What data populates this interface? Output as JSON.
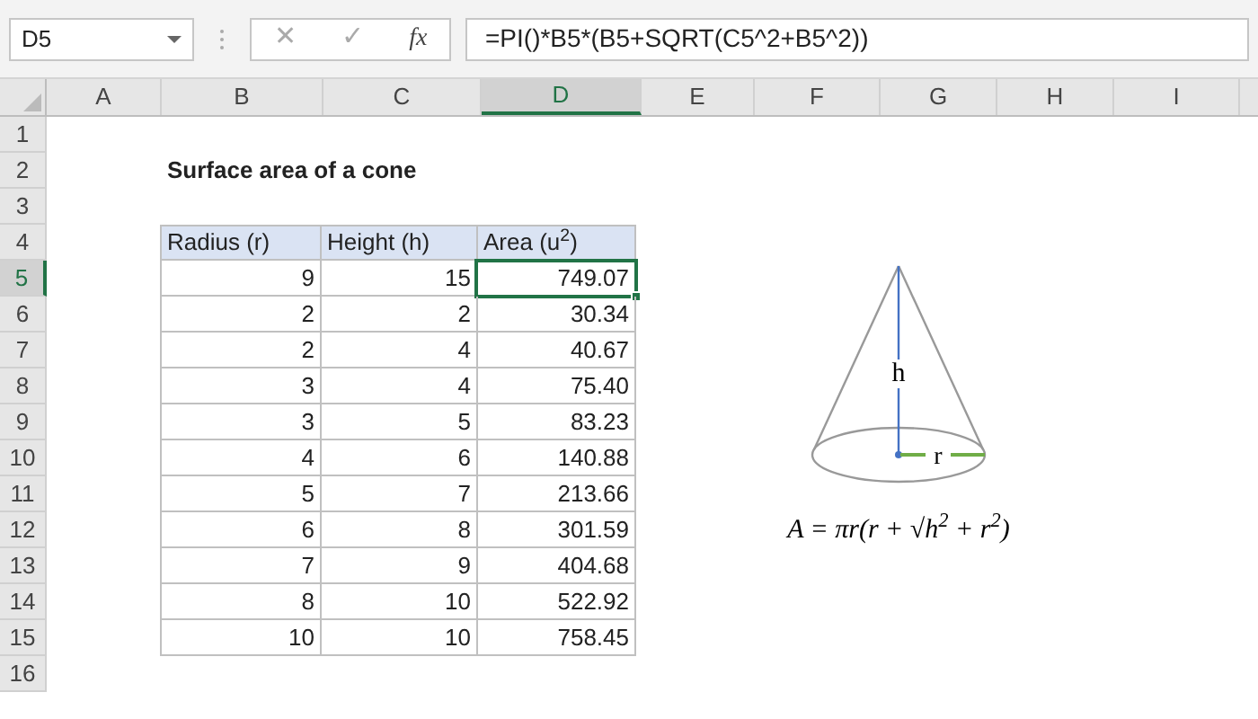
{
  "name_box": "D5",
  "formula_bar": {
    "cancel": "✕",
    "enter": "✓",
    "function": "fx",
    "formula": "=PI()*B5*(B5+SQRT(C5^2+B5^2))"
  },
  "columns": [
    {
      "label": "A",
      "selected": false
    },
    {
      "label": "B",
      "selected": false
    },
    {
      "label": "C",
      "selected": false
    },
    {
      "label": "D",
      "selected": true
    },
    {
      "label": "E",
      "selected": false
    },
    {
      "label": "F",
      "selected": false
    },
    {
      "label": "G",
      "selected": false
    },
    {
      "label": "H",
      "selected": false
    },
    {
      "label": "I",
      "selected": false
    }
  ],
  "row_headers": [
    {
      "label": "1",
      "selected": false
    },
    {
      "label": "2",
      "selected": false
    },
    {
      "label": "3",
      "selected": false
    },
    {
      "label": "4",
      "selected": false
    },
    {
      "label": "5",
      "selected": true
    },
    {
      "label": "6",
      "selected": false
    },
    {
      "label": "7",
      "selected": false
    },
    {
      "label": "8",
      "selected": false
    },
    {
      "label": "9",
      "selected": false
    },
    {
      "label": "10",
      "selected": false
    },
    {
      "label": "11",
      "selected": false
    },
    {
      "label": "12",
      "selected": false
    },
    {
      "label": "13",
      "selected": false
    },
    {
      "label": "14",
      "selected": false
    },
    {
      "label": "15",
      "selected": false
    },
    {
      "label": "16",
      "selected": false
    }
  ],
  "title": "Surface area of a cone",
  "table": {
    "columns": [
      "Radius (r)",
      "Height (h)",
      "Area (u$^{2}$)"
    ],
    "rows": [
      [
        "9",
        "15",
        "749.07"
      ],
      [
        "2",
        "2",
        "30.34"
      ],
      [
        "2",
        "4",
        "40.67"
      ],
      [
        "3",
        "4",
        "75.40"
      ],
      [
        "3",
        "5",
        "83.23"
      ],
      [
        "4",
        "6",
        "140.88"
      ],
      [
        "5",
        "7",
        "213.66"
      ],
      [
        "6",
        "8",
        "301.59"
      ],
      [
        "7",
        "9",
        "404.68"
      ],
      [
        "8",
        "10",
        "522.92"
      ],
      [
        "10",
        "10",
        "758.45"
      ]
    ]
  },
  "diagram": {
    "height_label": "h",
    "radius_label": "r",
    "formula": "A = πr(r + √h$^{2}$ + r$^{2}$)"
  }
}
